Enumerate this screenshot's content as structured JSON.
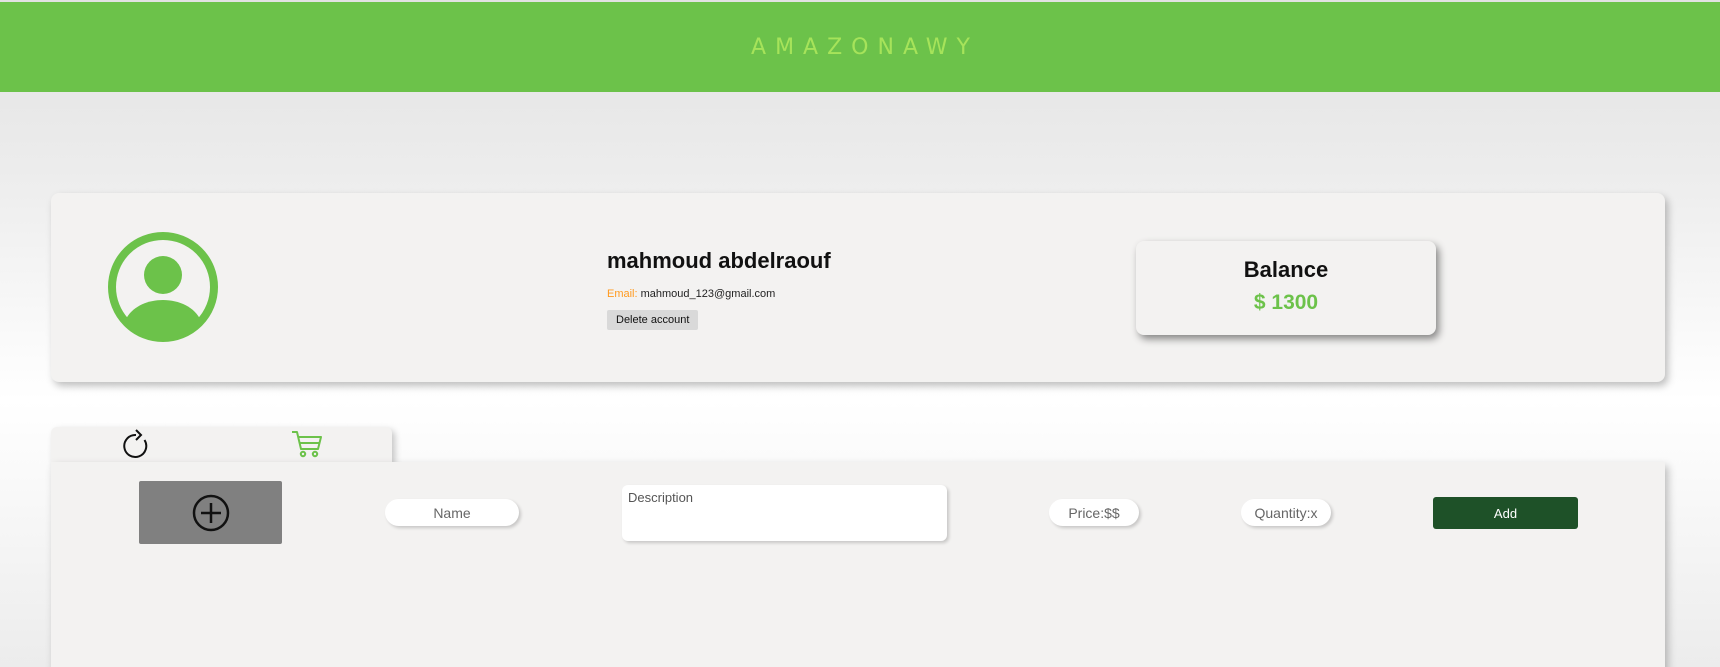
{
  "header": {
    "brand": "AMAZONAWY"
  },
  "colors": {
    "brand_green": "#6cc24a",
    "brand_light": "#a6e35a",
    "add_button": "#1e5128",
    "email_label": "#ff9a1f"
  },
  "profile": {
    "avatar_icon": "user-circle-icon",
    "name": "mahmoud abdelraouf",
    "email_label": "Email:",
    "email": "mahmoud_123@gmail.com",
    "delete_label": "Delete account"
  },
  "balance": {
    "title": "Balance",
    "amount": "$ 1300"
  },
  "tabs": [
    {
      "icon": "refresh-icon"
    },
    {
      "icon": "cart-icon"
    }
  ],
  "product_form": {
    "image_icon": "plus-circle-icon",
    "name_placeholder": "Name",
    "description_placeholder": "Description",
    "price_placeholder": "Price:$$",
    "quantity_placeholder": "Quantity:x",
    "add_label": "Add"
  }
}
